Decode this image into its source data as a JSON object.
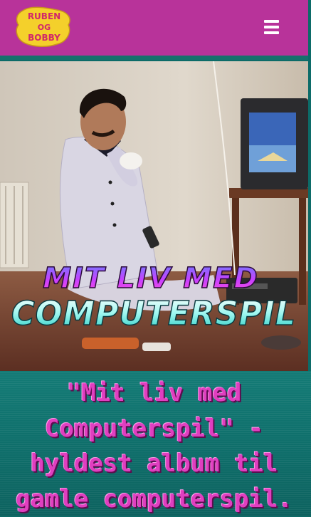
{
  "header": {
    "logo": {
      "line1": "RUBEN",
      "line2": "OG",
      "line3": "BOBBY",
      "fill": "#f4d02b",
      "text": "#d1276a"
    },
    "menu_icon": "hamburger-menu-icon",
    "background": "#b8339a"
  },
  "hero": {
    "overlay_line1": "MIT LIV MED",
    "overlay_line2": "COMPUTERSPIL",
    "line1_color": "#c940ff",
    "line2_color": "#55f0e6"
  },
  "article": {
    "title_lines": [
      "\"Mit liv med",
      "Computerspil\" -",
      "hyldest album til",
      "gamle computerspil."
    ],
    "title_color": "#e03fc0"
  }
}
